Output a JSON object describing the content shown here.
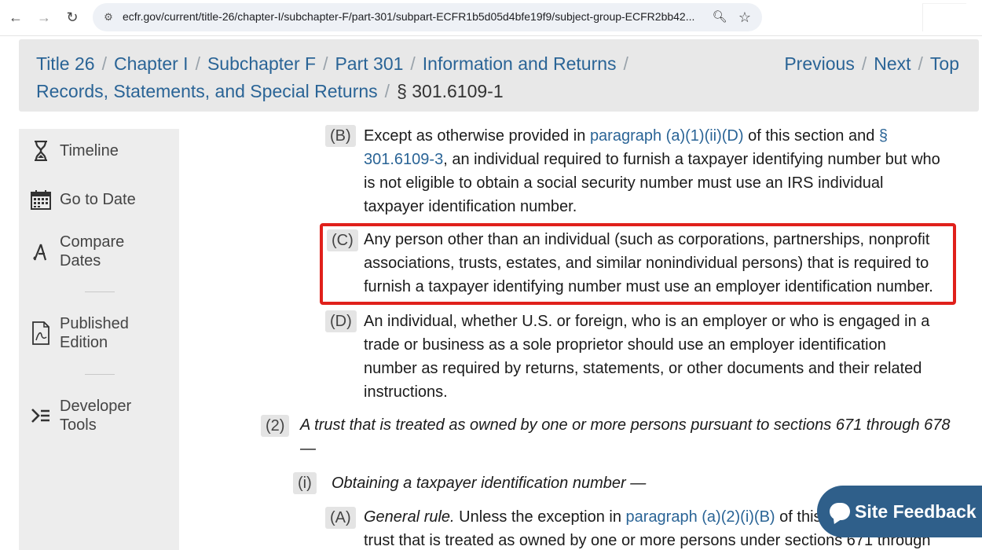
{
  "browser": {
    "url": "ecfr.gov/current/title-26/chapter-I/subchapter-F/part-301/subpart-ECFR1b5d05d4bfe19f9/subject-group-ECFR2bb42..."
  },
  "breadcrumb": {
    "items": [
      "Title 26",
      "Chapter I",
      "Subchapter F",
      "Part 301",
      "Information and Returns",
      "Records, Statements, and Special Returns"
    ],
    "current": "§ 301.6109-1"
  },
  "pager": {
    "previous": "Previous",
    "next": "Next",
    "top": "Top"
  },
  "sidebar": {
    "items": [
      {
        "label": "Timeline",
        "icon": "hourglass-icon"
      },
      {
        "label": "Go to Date",
        "icon": "calendar-icon"
      },
      {
        "label_line1": "Compare",
        "label_line2": "Dates",
        "icon": "compare-icon"
      },
      {
        "label_line1": "Published",
        "label_line2": "Edition",
        "icon": "document-icon"
      },
      {
        "label_line1": "Developer",
        "label_line2": "Tools",
        "icon": "developer-icon"
      }
    ]
  },
  "content": {
    "paraB": {
      "marker": "(B)",
      "text1": "Except as otherwise provided in ",
      "link1": "paragraph (a)(1)(ii)(D)",
      "text2": " of this section and ",
      "link2_line1": "§",
      "link2_line2": "301.6109-3",
      "text3": ", an individual required to furnish a taxpayer identifying number but who",
      "line3": "is not eligible to obtain a social security number must use an IRS individual",
      "line4": "taxpayer identification number."
    },
    "paraC": {
      "marker": "(C)",
      "line1": "Any person other than an individual (such as corporations, partnerships, nonprofit",
      "line2": "associations, trusts, estates, and similar nonindividual persons) that is required to",
      "line3": "furnish a taxpayer identifying number must use an employer identification number."
    },
    "paraD": {
      "marker": "(D)",
      "line1": "An individual, whether U.S. or foreign, who is an employer or who is engaged in a",
      "line2": "trade or business as a sole proprietor should use an employer identification",
      "line3": "number as required by returns, statements, or other documents and their related",
      "line4": "instructions."
    },
    "para2": {
      "marker": "(2)",
      "line1": "A trust that is treated as owned by one or more persons pursuant to sections 671 through 678",
      "line2": "—"
    },
    "parai": {
      "marker": "(i)",
      "text": "Obtaining a taxpayer identification number —"
    },
    "paraA": {
      "marker": "(A)",
      "heading": "General rule.",
      "text1": " Unless the exception in ",
      "link": "paragraph (a)(2)(i)(B)",
      "text2": " of this",
      "line2": "trust that is treated as owned by one or more persons under sections 671 through"
    }
  },
  "feedback": {
    "label": "Site Feedback"
  },
  "colors": {
    "link": "#2a6496",
    "highlight_border": "#e0201b",
    "feedback_bg": "#2f5f8a"
  }
}
